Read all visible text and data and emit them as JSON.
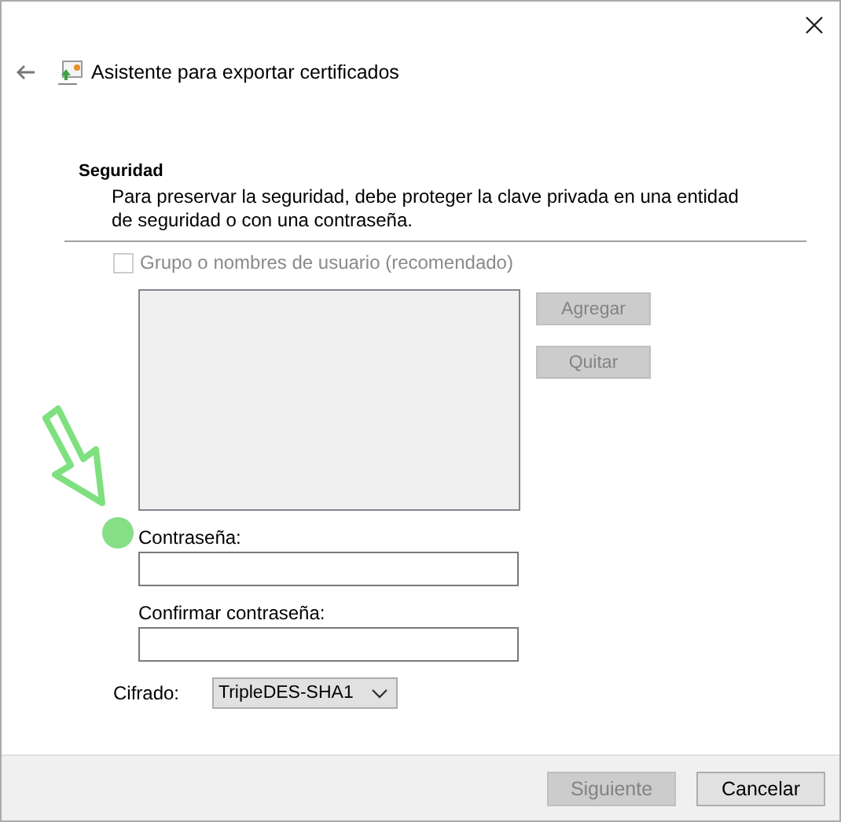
{
  "header": {
    "title": "Asistente para exportar certificados"
  },
  "section": {
    "heading": "Seguridad",
    "description": "Para preservar la seguridad, debe proteger la clave privada en una entidad de seguridad o con una contraseña."
  },
  "group_option": {
    "label": "Grupo o nombres de usuario (recomendado)",
    "checked": false,
    "disabled": true
  },
  "principal_buttons": [
    {
      "label": "Agregar",
      "disabled": true
    },
    {
      "label": "Quitar",
      "disabled": true
    }
  ],
  "password_fields": [
    {
      "label": "Contraseña:"
    },
    {
      "label": "Confirmar contraseña:"
    }
  ],
  "encryption": {
    "label": "Cifrado:",
    "value": "TripleDES-SHA1"
  },
  "footer_buttons": [
    {
      "label": "Siguiente",
      "disabled": true
    },
    {
      "label": "Cancelar",
      "disabled": false
    }
  ]
}
